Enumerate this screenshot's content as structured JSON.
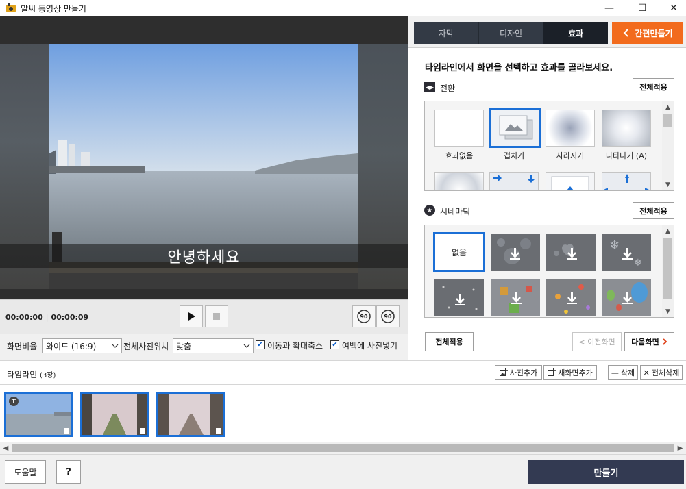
{
  "window": {
    "title": "알씨 동영상 만들기",
    "minimize_glyph": "—",
    "maximize_glyph": "☐",
    "close_glyph": "✕"
  },
  "preview": {
    "subtitle": "안녕하세요"
  },
  "transport": {
    "current_time": "00:00:00",
    "total_time": "00:00:09",
    "rotate_left_label": "90",
    "rotate_right_label": "90"
  },
  "settings": {
    "ratio_label": "화면비율",
    "ratio_value": "와이드 (16:9)",
    "position_label": "전체사진위치",
    "position_value": "맞춤",
    "zoom_label": "이동과 확대축소",
    "zoom_checked": true,
    "margin_label": "여백에 사진넣기",
    "margin_checked": true
  },
  "tabs": [
    {
      "label": "자막",
      "active": false
    },
    {
      "label": "디자인",
      "active": false
    },
    {
      "label": "효과",
      "active": true
    }
  ],
  "easy_make_button": "간편만들기",
  "instruction": "타임라인에서 화면을 선택하고 효과를 골라보세요.",
  "transition": {
    "title": "전환",
    "apply_all": "전체적용",
    "items": [
      {
        "label": "효과없음"
      },
      {
        "label": "겹치기"
      },
      {
        "label": "사라지기"
      },
      {
        "label": "나타나기 (A)"
      }
    ]
  },
  "cinematic": {
    "title": "시네마틱",
    "apply_all": "전체적용",
    "none_label": "없음"
  },
  "panel_footer": {
    "apply_all": "전체적용",
    "prev": "< 이전화면",
    "next": "다음화면"
  },
  "timeline": {
    "title": "타임라인",
    "count": "(3장)",
    "add_photo": "사진추가",
    "add_screen": "새화면추가",
    "delete": "삭제",
    "delete_all": "전체삭제",
    "badge": "T"
  },
  "bottom": {
    "help": "도움말",
    "question": "?",
    "make": "만들기"
  },
  "colors": {
    "accent_orange": "#f26b1d",
    "selection_blue": "#1b6fd6",
    "dark_tab": "#333a45",
    "make_button": "#333a52"
  }
}
